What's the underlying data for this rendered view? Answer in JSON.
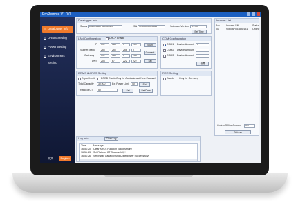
{
  "app": {
    "title": "ProRemote V1.0.0"
  },
  "sidebar": {
    "items": [
      {
        "label": "Datalogger Info"
      },
      {
        "label": "DRMS Setting"
      },
      {
        "label": "Power Setting"
      },
      {
        "label": "Environment Setting"
      }
    ],
    "lang_cn": "中文",
    "lang_en": "English"
  },
  "logger_info": {
    "title": "Datalogger Info",
    "status_label": "Status",
    "status_value": "Connection Succeeded",
    "sn_label": "SN",
    "sn_value": "SN000000C3985",
    "sw_label": "Software Version",
    "sw_value": "V1.00",
    "settime_label": "Set Time"
  },
  "lan": {
    "title": "LAN Configuration",
    "dhcp_label": "DHCP Enable",
    "ip_label": "IP",
    "ip": [
      "192",
      "168",
      "1",
      "200"
    ],
    "mask_label": "Subnet Mask",
    "mask": [
      "255",
      "255",
      "255",
      "0"
    ],
    "gw_label": "Gateway",
    "gw": [
      "192",
      "168",
      "1",
      "254"
    ],
    "dns_label": "DNS",
    "dns": [
      "208",
      "67",
      "222",
      "222"
    ],
    "scan_label": "Scan",
    "connect_label": "Connect",
    "set_label": "Set"
  },
  "com": {
    "title": "COM Configuration",
    "ports": [
      {
        "name": "COM1",
        "checked": true,
        "amount_label": "Device Amount",
        "amount": "1"
      },
      {
        "name": "COM2",
        "checked": false,
        "amount_label": "Device Amount",
        "amount": ""
      },
      {
        "name": "COM3",
        "checked": false,
        "amount_label": "Device Amount",
        "amount": ""
      }
    ],
    "set_label": "设置"
  },
  "drms": {
    "title": "DRMS & ARCS Setting",
    "export_label": "Export Limit",
    "drms_label": "DRED Enable",
    "drms_note": "Only for Australia and New Zealand",
    "capacity_label": "Total Capacity",
    "capacity": "30,000",
    "power_label": "Ext Power Limit",
    "power": "40",
    "set_label": "Set",
    "ct_label": "Ratio of CT",
    "ct": "50",
    "set2_label": "Set",
    "setdata_label": "Set Data"
  },
  "rcr": {
    "title": "RCR Setting",
    "enable_label": "Enable",
    "note": "Only for Germany"
  },
  "inverter": {
    "title": "Inverter List",
    "headers": [
      "No.",
      "Inverter SN",
      "Status"
    ],
    "rows": [
      [
        "01",
        "9060BPT518A0131",
        "Online"
      ]
    ],
    "online_label": "Online/Offline Amount",
    "online_value": "1/0",
    "refresh_label": "Refresh"
  },
  "log": {
    "title": "Log Info",
    "clear_label": "Clear Log",
    "headers": [
      "Time",
      "Message"
    ],
    "rows": [
      [
        "16:51:20",
        "Clear ARCS Function Successfully!"
      ],
      [
        "16:51:23",
        "Set Ratio of CT Successfully!"
      ],
      [
        "16:51:26",
        "Set Install Capacity And Upperpower Successfully!"
      ]
    ]
  }
}
